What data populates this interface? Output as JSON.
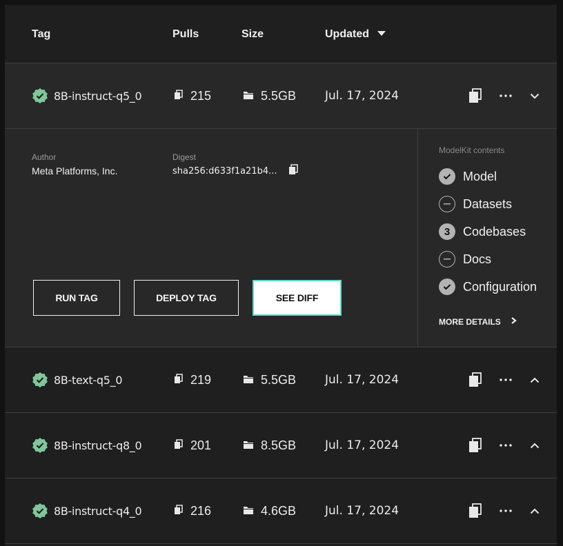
{
  "table": {
    "columns": {
      "tag": "Tag",
      "pulls": "Pulls",
      "size": "Size",
      "updated": "Updated"
    },
    "sort": {
      "column": "updated",
      "direction": "descending"
    },
    "rows": [
      {
        "tag": "8B-instruct-q5_0",
        "pulls": "215",
        "size": "5.5GB",
        "updated": "Jul. 17, 2024",
        "expanded": true
      },
      {
        "tag": "8B-text-q5_0",
        "pulls": "219",
        "size": "5.5GB",
        "updated": "Jul. 17, 2024",
        "expanded": false
      },
      {
        "tag": "8B-instruct-q8_0",
        "pulls": "201",
        "size": "8.5GB",
        "updated": "Jul. 17, 2024",
        "expanded": false
      },
      {
        "tag": "8B-instruct-q4_0",
        "pulls": "216",
        "size": "4.6GB",
        "updated": "Jul. 17, 2024",
        "expanded": false
      }
    ]
  },
  "details": {
    "author_label": "Author",
    "author": "Meta Platforms, Inc.",
    "digest_label": "Digest",
    "digest": "sha256:d633f1a21b4...",
    "buttons": {
      "run": "RUN TAG",
      "deploy": "DEPLOY TAG",
      "diff": "SEE DIFF"
    },
    "modelkit": {
      "title": "ModelKit contents",
      "items": [
        {
          "label": "Model",
          "status": "included",
          "icon": "check"
        },
        {
          "label": "Datasets",
          "status": "none",
          "icon": "minus"
        },
        {
          "label": "Codebases",
          "status": "count",
          "icon": "3"
        },
        {
          "label": "Docs",
          "status": "none",
          "icon": "minus"
        },
        {
          "label": "Configuration",
          "status": "included",
          "icon": "check"
        }
      ],
      "more_details": "MORE DETAILS"
    }
  },
  "colors": {
    "verified_badge": "#7fc79a",
    "accent_border": "#62d8d0",
    "background": "#121212",
    "panel": "#1f1f1f",
    "expanded_row": "#282828"
  }
}
